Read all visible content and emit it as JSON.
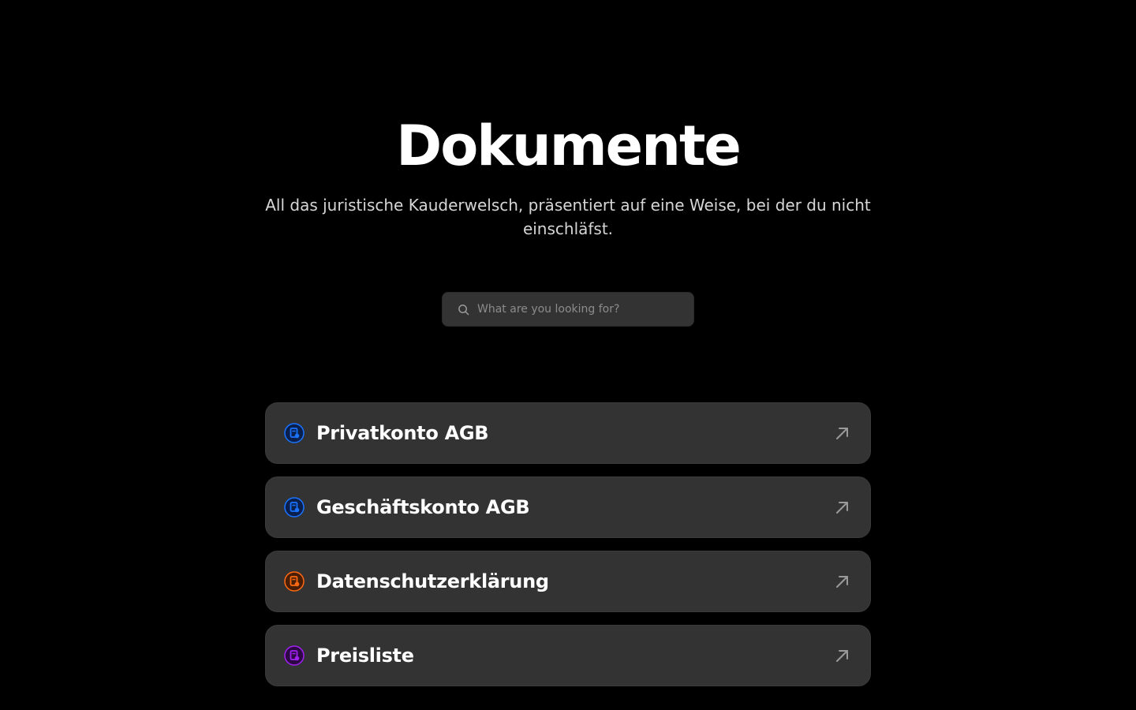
{
  "header": {
    "title": "Dokumente",
    "subtitle": "All das juristische Kauderwelsch, präsentiert auf eine Weise, bei der du nicht einschläfst."
  },
  "search": {
    "placeholder": "What are you looking for?",
    "value": "",
    "icon": "search-icon"
  },
  "documents": [
    {
      "label": "Privatkonto AGB",
      "icon": "document-icon",
      "icon_color": "#1a73ff",
      "icon_bg": "#0b1f4d"
    },
    {
      "label": "Geschäftskonto AGB",
      "icon": "document-icon",
      "icon_color": "#1a73ff",
      "icon_bg": "#0b1f4d"
    },
    {
      "label": "Datenschutzerklärung",
      "icon": "document-icon",
      "icon_color": "#ff6a13",
      "icon_bg": "#4a1e05"
    },
    {
      "label": "Preisliste",
      "icon": "document-icon",
      "icon_color": "#a020f0",
      "icon_bg": "#2e0845"
    }
  ],
  "colors": {
    "background": "#000000",
    "card": "#333333",
    "arrow": "#9a9a9a"
  }
}
